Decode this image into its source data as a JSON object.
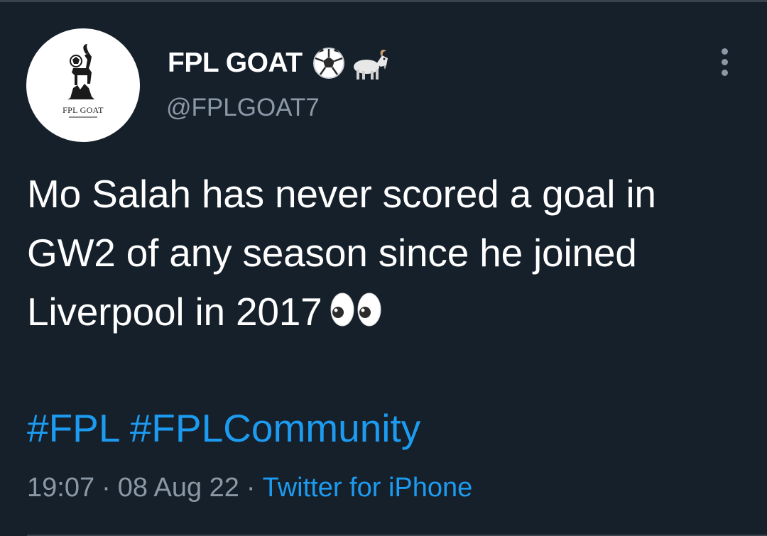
{
  "author": {
    "display_name": "FPL GOAT",
    "handle": "@FPLGOAT7",
    "avatar_caption": "FPL GOAT",
    "name_emojis": [
      "soccer-ball-icon",
      "goat-icon"
    ]
  },
  "tweet": {
    "text": "Mo Salah has never scored a goal in GW2 of any season since he joined Liverpool in 2017",
    "trailing_emoji": "eyes-icon",
    "hashtags": [
      "#FPL",
      "#FPLCommunity"
    ]
  },
  "meta": {
    "time": "19:07",
    "separator": "·",
    "date": "08 Aug 22",
    "source": "Twitter for iPhone"
  },
  "colors": {
    "background": "#15202b",
    "text": "#ffffff",
    "secondary": "#8b98a5",
    "link": "#1d9bf0",
    "divider": "#38444d"
  }
}
